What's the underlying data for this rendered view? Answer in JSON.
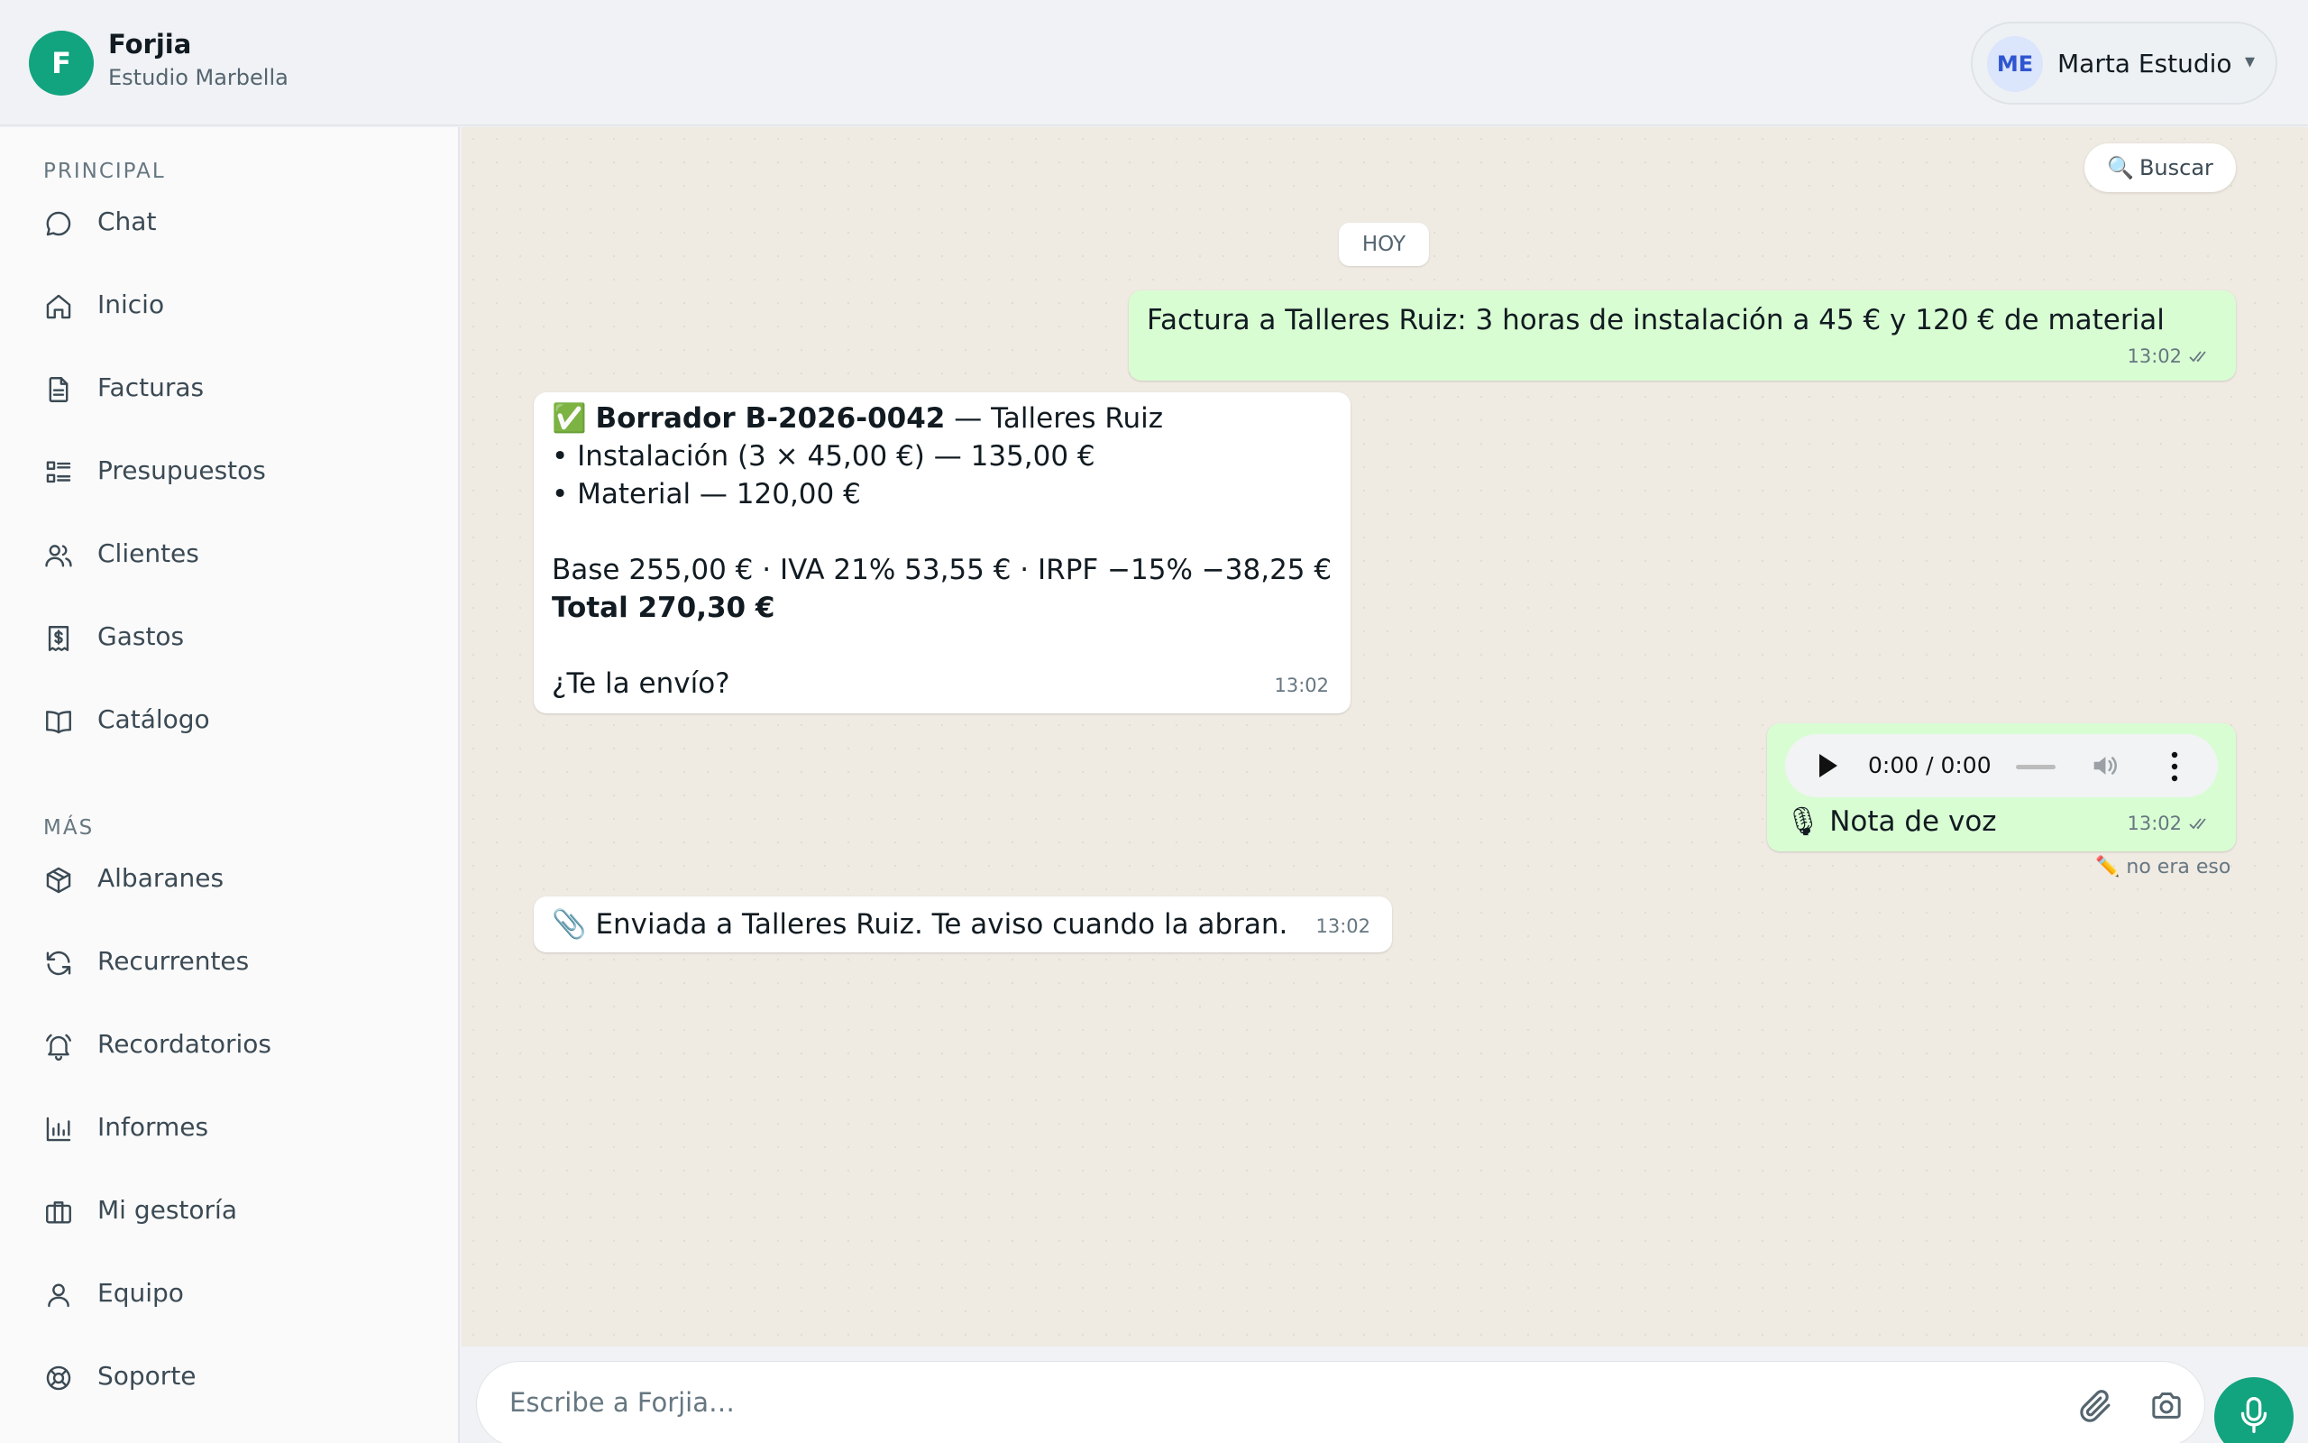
{
  "header": {
    "logo_letter": "F",
    "app_name": "Forjia",
    "workspace": "Estudio Marbella",
    "user_initials": "ME",
    "user_name": "Marta Estudio",
    "user_caret": "▾"
  },
  "sidebar": {
    "section_main": "PRINCIPAL",
    "section_more": "MÁS",
    "main_items": [
      {
        "label": "Chat",
        "icon": "chat-bubble-icon"
      },
      {
        "label": "Inicio",
        "icon": "home-icon"
      },
      {
        "label": "Facturas",
        "icon": "document-icon"
      },
      {
        "label": "Presupuestos",
        "icon": "list-icon"
      },
      {
        "label": "Clientes",
        "icon": "users-icon"
      },
      {
        "label": "Gastos",
        "icon": "receipt-icon"
      },
      {
        "label": "Catálogo",
        "icon": "book-icon"
      }
    ],
    "more_items": [
      {
        "label": "Albaranes",
        "icon": "package-icon"
      },
      {
        "label": "Recurrentes",
        "icon": "refresh-icon"
      },
      {
        "label": "Recordatorios",
        "icon": "bell-icon"
      },
      {
        "label": "Informes",
        "icon": "bar-chart-icon"
      },
      {
        "label": "Mi gestoría",
        "icon": "briefcase-icon"
      },
      {
        "label": "Equipo",
        "icon": "user-icon"
      },
      {
        "label": "Soporte",
        "icon": "lifebuoy-icon"
      }
    ]
  },
  "chat": {
    "search_label": "Buscar",
    "date_chip": "HOY",
    "messages": [
      {
        "text": "Factura a Talleres Ruiz: 3 horas de instalación a 45 € y 120 € de material",
        "time": "13:02"
      },
      {
        "check": "✅",
        "draft_id": "Borrador B-2026-0042",
        "client": " — Talleres Ruiz",
        "line1": "• Instalación (3 × 45,00 €) — 135,00 €",
        "line2": "• Material — 120,00 €",
        "summary": "Base 255,00 € · IVA 21% 53,55 € · IRPF −15% −38,25 €",
        "total": "Total 270,30 €",
        "question": "¿Te la envío?",
        "time": "13:02"
      },
      {
        "audio_time": "0:00 / 0:00",
        "voice_label": "🎙 Nota de voz",
        "time": "13:02",
        "edit_note": "✏️ no era eso"
      },
      {
        "text": "📎 Enviada a Talleres Ruiz. Te aviso cuando la abran.",
        "time": "13:02"
      }
    ]
  },
  "composer": {
    "placeholder": "Escribe a Forjia…"
  },
  "colors": {
    "brand": "#12a37f",
    "outgoing_bubble": "#d9fdd3",
    "chat_background": "#efeae2"
  }
}
